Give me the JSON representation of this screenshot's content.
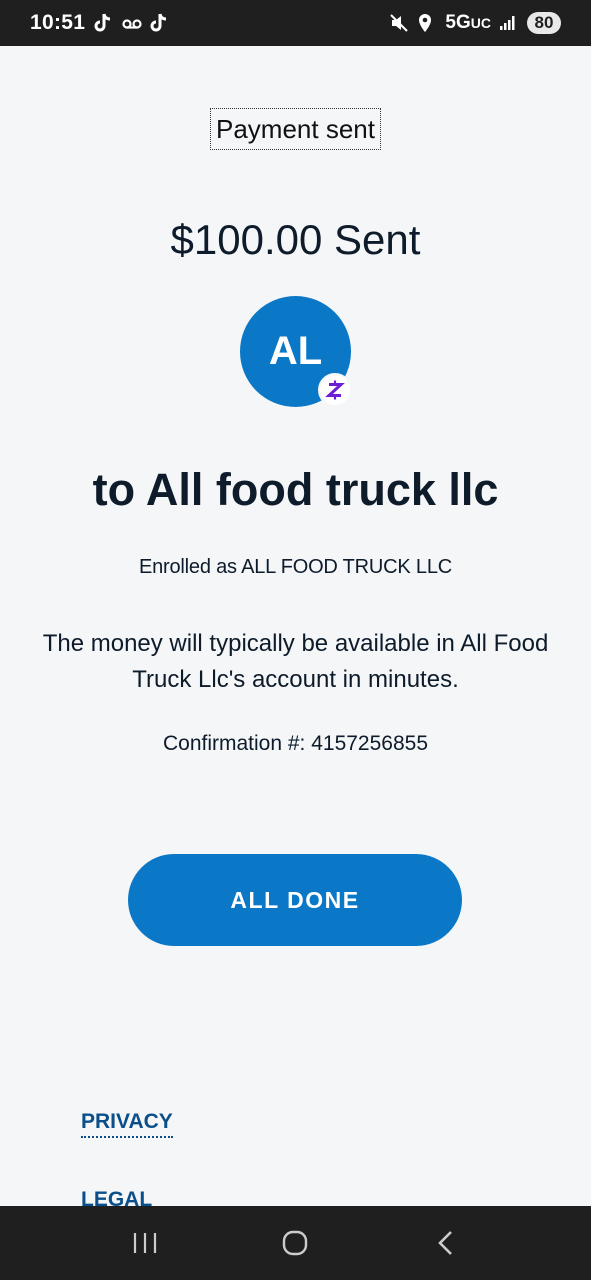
{
  "status_bar": {
    "time": "10:51",
    "network": "5G",
    "network_sub": "UC",
    "battery": "80"
  },
  "page": {
    "header_title": "Payment sent",
    "amount_text": "$100.00 Sent",
    "avatar_initials": "AL",
    "recipient_text": "to All food truck llc",
    "enrolled_text": "Enrolled as ALL FOOD TRUCK LLC",
    "message_text": "The money will typically be available in All Food Truck Llc's account in minutes.",
    "confirmation_text": "Confirmation #: 4157256855",
    "done_button": "ALL DONE",
    "privacy_link": "PRIVACY",
    "legal_link": "LEGAL"
  },
  "colors": {
    "accent": "#0a78c6",
    "zelle_purple": "#6d1ed4",
    "link": "#0b4f8a",
    "background": "#f4f6f8"
  },
  "icons": {
    "status_left": [
      "tiktok-icon",
      "voicemail-icon",
      "tiktok-icon"
    ],
    "status_right": [
      "mute-icon",
      "location-icon",
      "signal-icon"
    ],
    "badge": "zelle-icon",
    "nav": [
      "recent-apps-icon",
      "home-icon",
      "back-icon"
    ]
  }
}
